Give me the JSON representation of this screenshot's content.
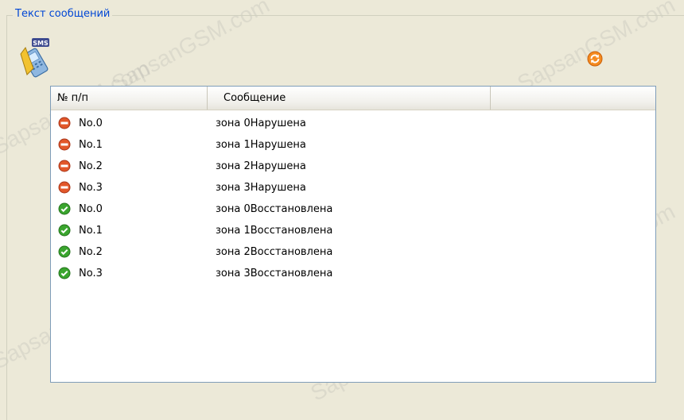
{
  "group": {
    "title": "Текст сообщений"
  },
  "icons": {
    "sms": "sms-phone-icon",
    "refresh": "refresh-icon",
    "violation": "stop-icon",
    "restored": "check-icon"
  },
  "colors": {
    "violation": "#e2572a",
    "restored": "#3aa52e",
    "title": "#0046d5"
  },
  "list": {
    "columns": [
      "№ п/п",
      "Сообщение",
      ""
    ],
    "rows": [
      {
        "num": "No.0",
        "message": "зона 0Нарушена",
        "status": "violation"
      },
      {
        "num": "No.1",
        "message": "зона 1Нарушена",
        "status": "violation"
      },
      {
        "num": "No.2",
        "message": "зона 2Нарушена",
        "status": "violation"
      },
      {
        "num": "No.3",
        "message": "зона 3Нарушена",
        "status": "violation"
      },
      {
        "num": "No.0",
        "message": "зона 0Восстановлена",
        "status": "restored"
      },
      {
        "num": "No.1",
        "message": "зона 1Восстановлена",
        "status": "restored"
      },
      {
        "num": "No.2",
        "message": "зона 2Восстановлена",
        "status": "restored"
      },
      {
        "num": "No.3",
        "message": "зона 3Восстановлена",
        "status": "restored"
      }
    ]
  },
  "watermark": "SapsanGSM.com"
}
